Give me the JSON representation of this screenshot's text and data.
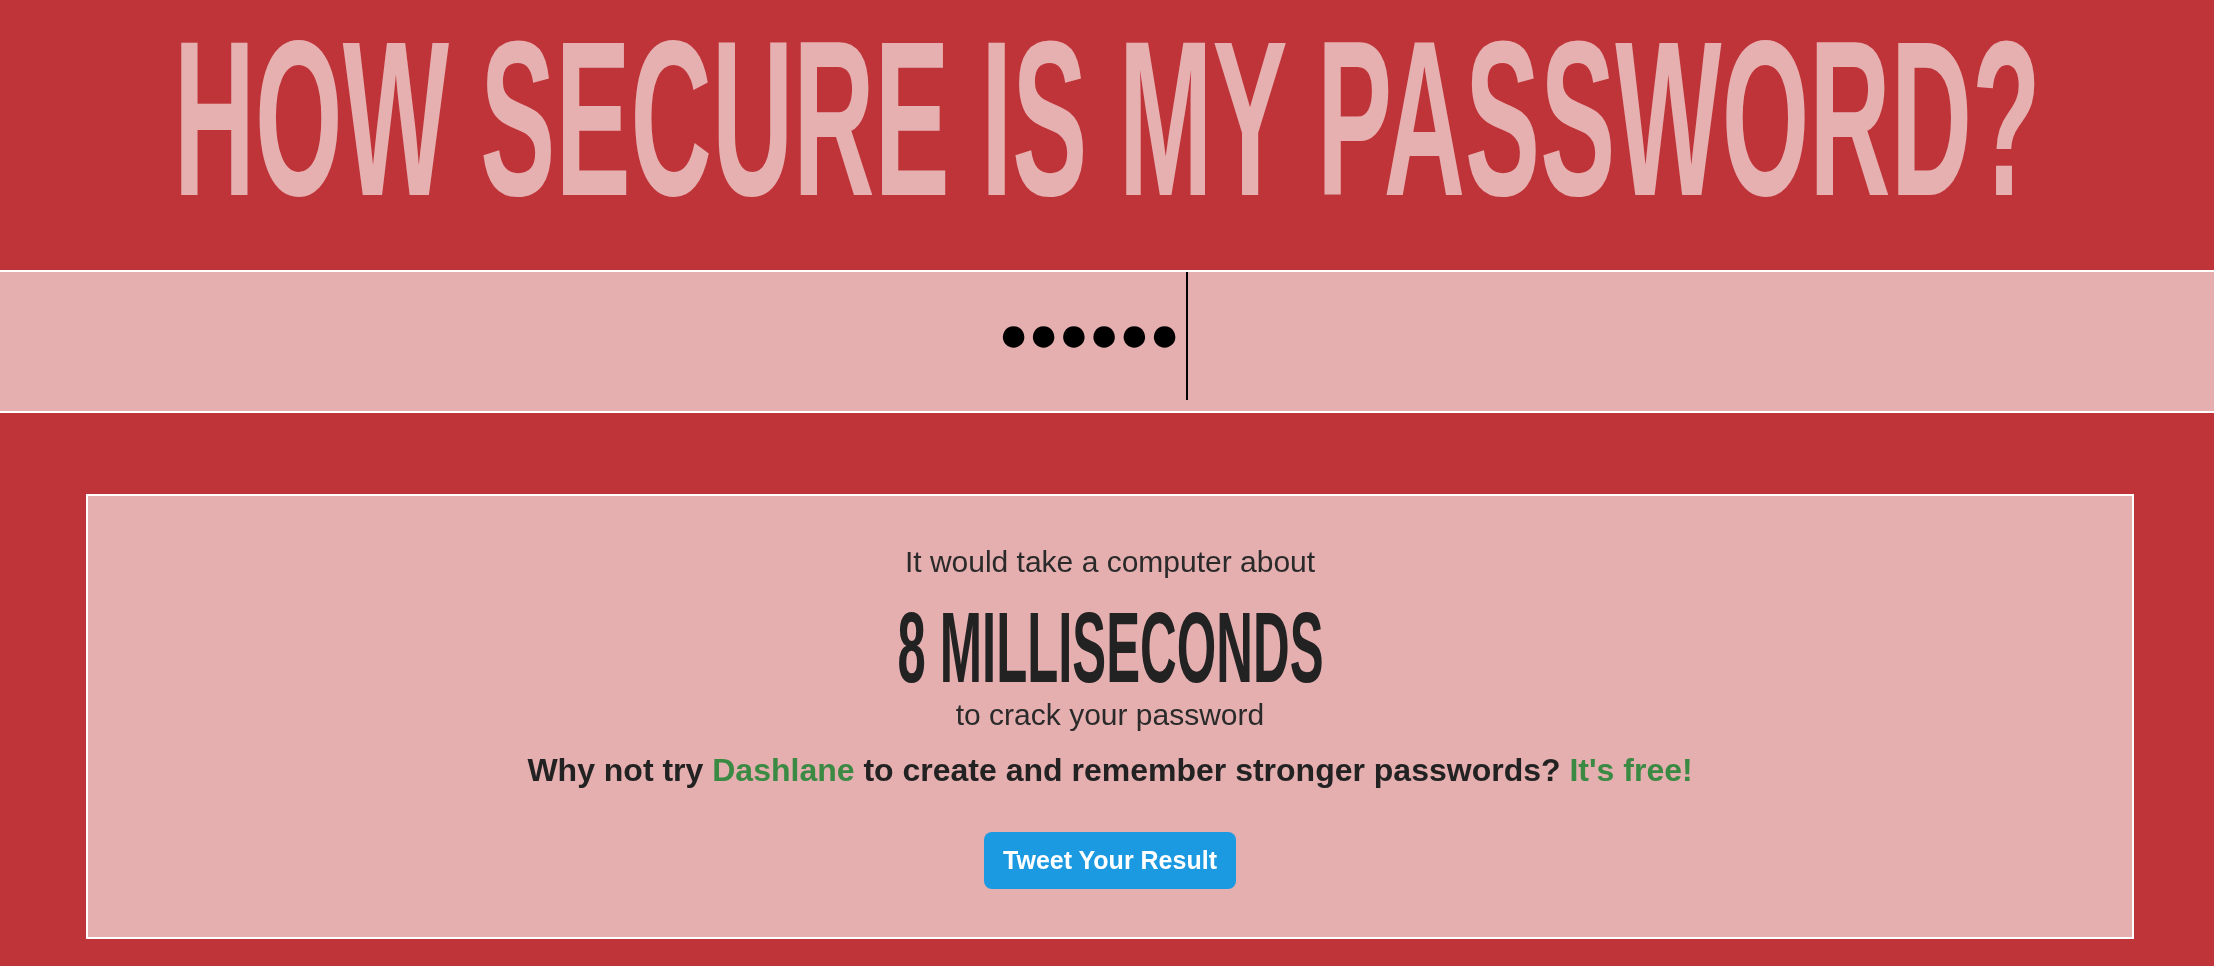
{
  "title": "HOW SECURE IS MY PASSWORD?",
  "password_field": {
    "value": "●●●●●●",
    "focused": true
  },
  "result": {
    "intro": "It would take a computer about",
    "time": "8 MILLISECONDS",
    "outro": "to crack your password",
    "promo": [
      {
        "kind": "text",
        "text": "Why not try "
      },
      {
        "kind": "link",
        "text": "Dashlane"
      },
      {
        "kind": "text",
        "text": " to create and remember stronger passwords? "
      },
      {
        "kind": "link",
        "text": "It's free!"
      }
    ],
    "button": "Tweet Your Result"
  }
}
